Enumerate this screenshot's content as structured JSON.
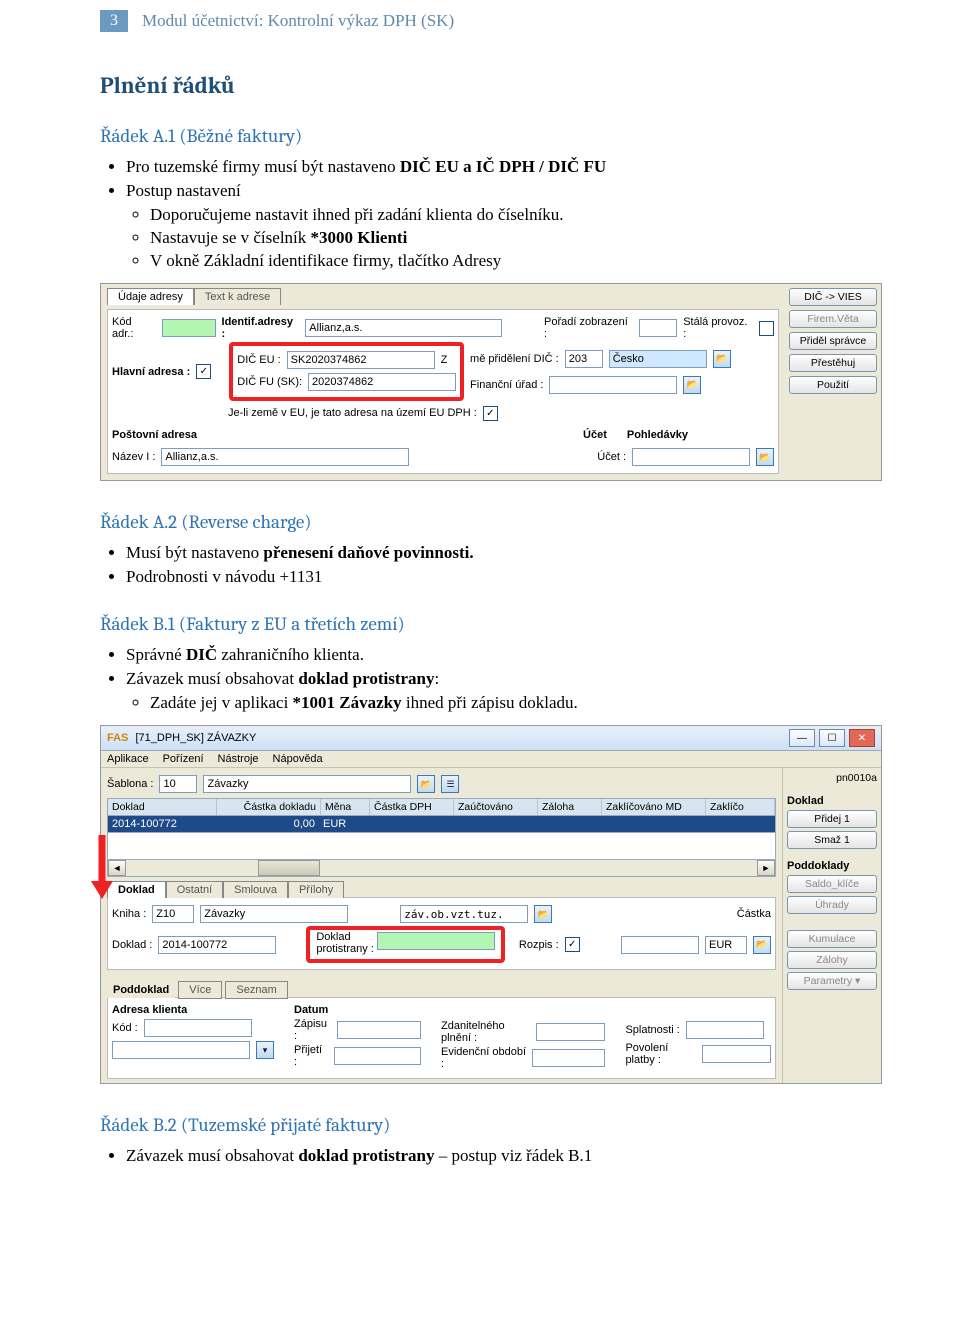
{
  "page": {
    "number": "3",
    "header_title": "Modul účetnictví: Kontrolní výkaz DPH (SK)"
  },
  "h_plneni": "Plnění řádků",
  "a1": {
    "title": "Řádek A.1 (Běžné faktury)",
    "b1_pre": "Pro tuzemské firmy musí být nastaveno ",
    "b1_bold": "DIČ EU a IČ DPH / DIČ FU",
    "b2": "Postup nastavení",
    "s1": "Doporučujeme nastavit ihned při zadání klienta do číselníku.",
    "s2_pre": "Nastavuje se v číselník ",
    "s2_bold": "*3000 Klienti",
    "s3": "V okně Základní identifikace firmy, tlačítko Adresy"
  },
  "shot1": {
    "tab_active": "Údaje adresy",
    "tab_inactive": "Text k adrese",
    "side": [
      "DIČ -> VIES",
      "Firem.Věta",
      "Přiděl správce",
      "Přestěhuj",
      "Použití"
    ],
    "lbl_kod": "Kód adr.:",
    "lbl_ident": "Identif.adresy :",
    "val_ident": "Allianz,a.s.",
    "lbl_poradi": "Pořadí zobrazení :",
    "lbl_stala": "Stálá provoz. :",
    "lbl_hlavni": "Hlavní adresa :",
    "chk_hlavni": "✓",
    "lbl_diceu": "DIČ EU :",
    "val_diceu": "SK2020374862",
    "lbl_z": "Z",
    "lbl_zeme": "mě přidělení DIČ :",
    "val_zcode": "203",
    "val_zname": "Česko",
    "lbl_dicfu": "DIČ FU (SK):",
    "val_dicfu": "2020374862",
    "lbl_finur": "Finanční úřad :",
    "lbl_euq": "Je-li země v EU, je tato adresa na území EU DPH :",
    "chk_eu": "✓",
    "lbl_postovni": "Poštovní adresa",
    "lbl_ucet_h": "Účet",
    "lbl_pohled": "Pohledávky",
    "lbl_nazev1": "Název I :",
    "val_nazev1": "Allianz,a.s.",
    "lbl_ucet": "Účet :"
  },
  "a2": {
    "title": "Řádek A.2 (Reverse charge)",
    "b1_pre": "Musí být nastaveno ",
    "b1_bold": "přenesení daňové povinnosti.",
    "b2": "Podrobnosti v návodu +1131"
  },
  "b1": {
    "title": "Řádek B.1 (Faktury z EU a třetích zemí)",
    "l1_pre": "Správné ",
    "l1_bold": "DIČ",
    "l1_post": " zahraničního klienta.",
    "l2_pre": "Závazek musí obsahovat ",
    "l2_bold": "doklad protistrany",
    "l2_post": ":",
    "s1_pre": "Zadáte jej v aplikaci ",
    "s1_bold": "*1001 Závazky",
    "s1_post": " ihned při zápisu dokladu."
  },
  "shot2": {
    "wintitle": "[71_DPH_SK] ZÁVAZKY",
    "menu": [
      "Aplikace",
      "Pořízení",
      "Nástroje",
      "Nápověda"
    ],
    "lbl_sablona": "Šablona :",
    "val_sab_n": "10",
    "val_sab_t": "Závazky",
    "val_pn": "pn0010a",
    "grid_head": [
      "Doklad",
      "Částka dokladu",
      "Měna",
      "Částka DPH",
      "Zaúčtováno",
      "Záloha",
      "Zaklíčováno MD",
      "Zaklíčo"
    ],
    "grid_doklad": "2014-100772",
    "grid_castka": "0,00",
    "grid_mena": "EUR",
    "side_head1": "Doklad",
    "btn_pridej": "Přidej 1",
    "btn_smaz": "Smaž 1",
    "side_head2": "Poddoklady",
    "btn_saldo": "Saldo_klíče",
    "btn_uhrady": "Úhrady",
    "btn_kumul": "Kumulace",
    "btn_zalohy": "Zálohy",
    "btn_param": "Parametry",
    "tabs": [
      "Doklad",
      "Ostatní",
      "Smlouva",
      "Přílohy"
    ],
    "lbl_kniha": "Kniha :",
    "val_kniha_n": "Z10",
    "val_kniha_t": "Závazky",
    "lbl_doklad": "Doklad :",
    "val_doklad": "2014-100772",
    "val_zav": "záv.ob.vzt.tuz.",
    "lbl_dokladprot": "Doklad\nprotistrany :",
    "lbl_rozpis": "Rozpis :",
    "chk_rozpis": "✓",
    "lbl_castka": "Částka",
    "val_mena": "EUR",
    "sect_poddoklad": "Poddoklad",
    "tab_vice": "Více",
    "tab_seznam": "Seznam",
    "lbl_adr_head": "Adresa klienta",
    "lbl_kod": "Kód :",
    "lbl_datum_head": "Datum",
    "lbl_zapisu": "Zápisu :",
    "lbl_zdan": "Zdanitelného plnění :",
    "lbl_splat": "Splatnosti :",
    "lbl_prijeti": "Přijetí :",
    "lbl_evid": "Evidenční období :",
    "lbl_povol": "Povolení platby :"
  },
  "b2": {
    "title": "Řádek B.2 (Tuzemské přijaté faktury)",
    "l1_pre": "Závazek musí obsahovat ",
    "l1_bold": "doklad protistrany",
    "l1_post": " – postup viz řádek B.1"
  }
}
